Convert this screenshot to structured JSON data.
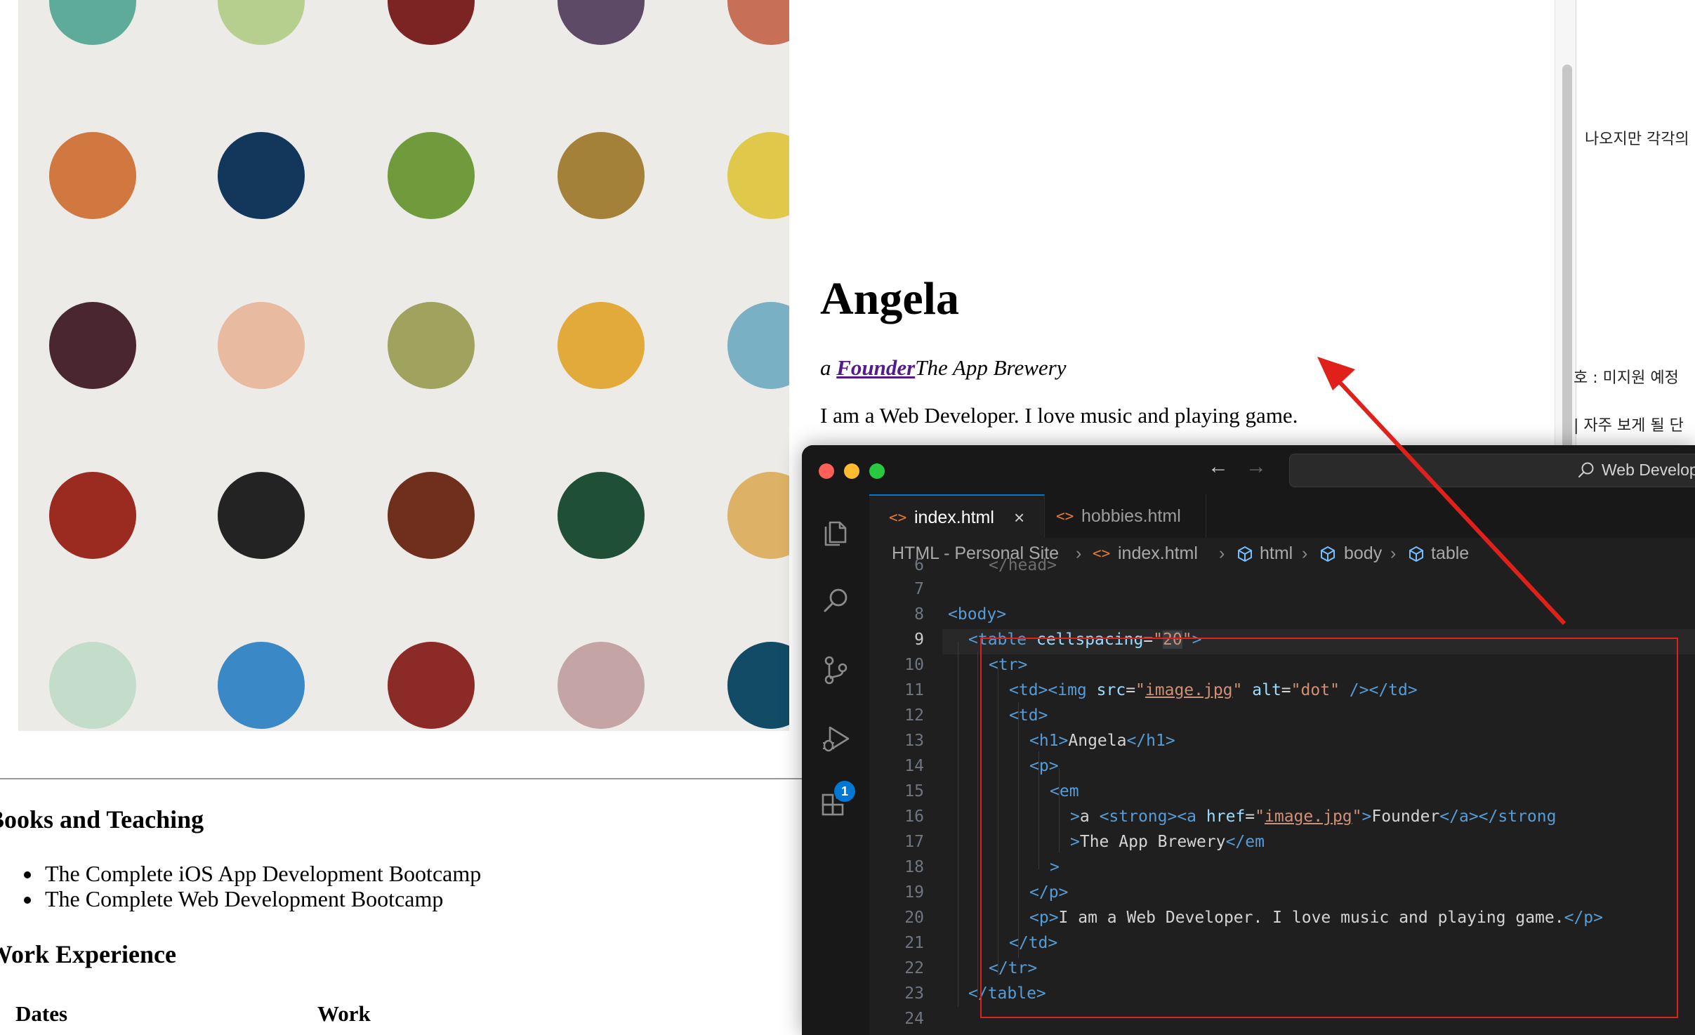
{
  "page": {
    "heading": "Angela",
    "tagline_prefix": "a ",
    "tagline_link": "Founder",
    "tagline_suffix": "The App Brewery",
    "bio": "I am a Web Developer. I love music and playing game.",
    "books_heading": "Books and Teaching",
    "books": [
      "The Complete iOS App Development Bootcamp",
      "The Complete Web Development Bootcamp"
    ],
    "work_heading": "Work Experience",
    "table_headers": [
      "Dates",
      "Work"
    ]
  },
  "background_window": {
    "lines": [
      "나오지만 각각의",
      "호 : 미지원 예정",
      "| 자주 보게 될 단"
    ]
  },
  "editor": {
    "command_center": "Web Development",
    "tabs": [
      {
        "label": "index.html",
        "active": true
      },
      {
        "label": "hobbies.html",
        "active": false
      }
    ],
    "breadcrumbs": [
      "HTML - Personal Site",
      "index.html",
      "html",
      "body",
      "table"
    ],
    "extensions_badge": "1",
    "line_numbers": [
      "6",
      "7",
      "8",
      "9",
      "10",
      "11",
      "12",
      "13",
      "14",
      "15",
      "16",
      "17",
      "18",
      "19",
      "20",
      "21",
      "22",
      "23",
      "24"
    ],
    "active_line": "9",
    "code": {
      "l6": "</head>",
      "l8_tag": "body",
      "l9_tag": "table",
      "l9_attr": "cellspacing",
      "l9_val": "20",
      "l11_src": "image.jpg",
      "l11_alt": "dot",
      "l13_text": "Angela",
      "l16_text": "a ",
      "l16_href": "image.jpg",
      "l16_link": "Founder",
      "l17_text": "The App Brewery",
      "l20_text": "I am a Web Developer. I love music and playing game."
    }
  },
  "colors": {
    "dots": [
      [
        "#5fab9a",
        "#b7cf8e",
        "#7c2324",
        "#5d4a66",
        "#c86f57"
      ],
      [
        "#d07840",
        "#13375b",
        "#6f9b3c",
        "#a38139",
        "#dfc84a"
      ],
      [
        "#4a2631",
        "#e8baa0",
        "#a0a35e",
        "#e1aa3a",
        "#7ab0c4"
      ],
      [
        "#9b2a20",
        "#232323",
        "#6f2f1c",
        "#1f4f37",
        "#ddb266"
      ],
      [
        "#c3ddca",
        "#3a89c6",
        "#8c2a28",
        "#c4a4a4",
        "#114b65"
      ]
    ],
    "annotation_red": "#e0201b",
    "accent_blue": "#0078d4"
  }
}
